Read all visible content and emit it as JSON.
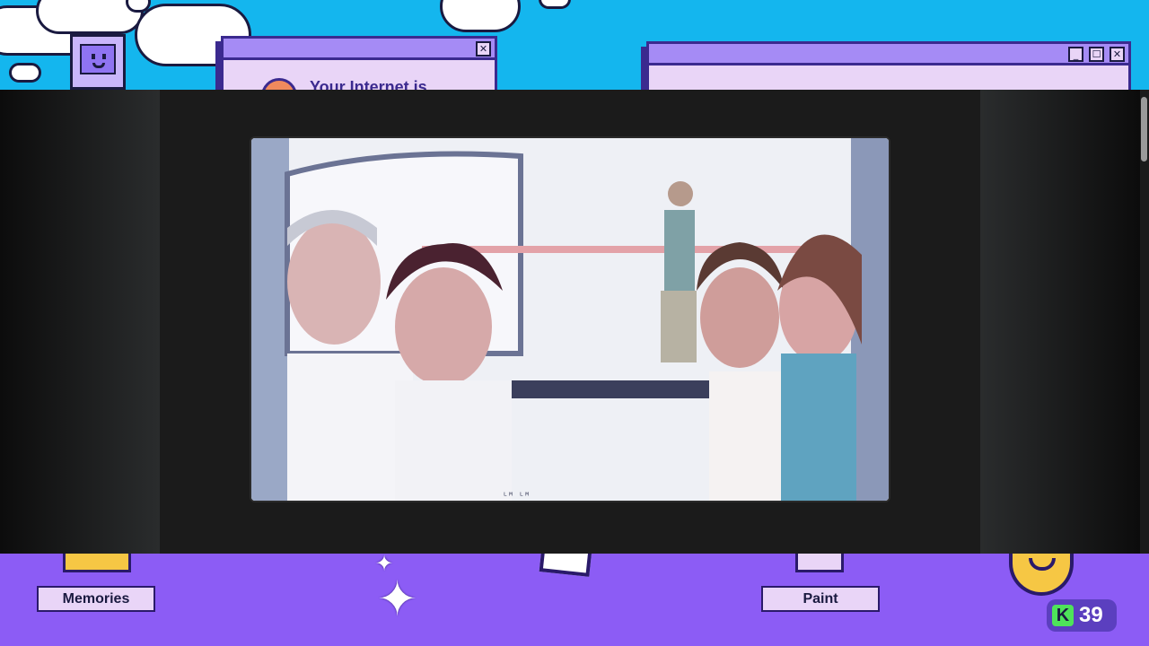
{
  "desktop": {
    "popup_title": "Your Internet is",
    "popup_close_glyph": "✕",
    "window_controls": [
      "_",
      "☐",
      "✕"
    ]
  },
  "photo_viewer": {
    "image_subject": "photo-people-in-gondola",
    "photo_caption_marks": "ᴸᴹ ᴸᴹ"
  },
  "taskbar": {
    "apps": [
      {
        "label": "Memories",
        "icon": "folder-icon"
      },
      {
        "label": "Paint",
        "icon": "paint-icon"
      }
    ],
    "sparkle_glyph": "✦",
    "counter": {
      "badge": "K",
      "value": "39"
    }
  },
  "colors": {
    "sky": "#14b6ee",
    "taskbar": "#8c5cf5",
    "window_bar": "#a58bf5",
    "window_body": "#e9d5f7",
    "counter_badge": "#4ee35a"
  }
}
